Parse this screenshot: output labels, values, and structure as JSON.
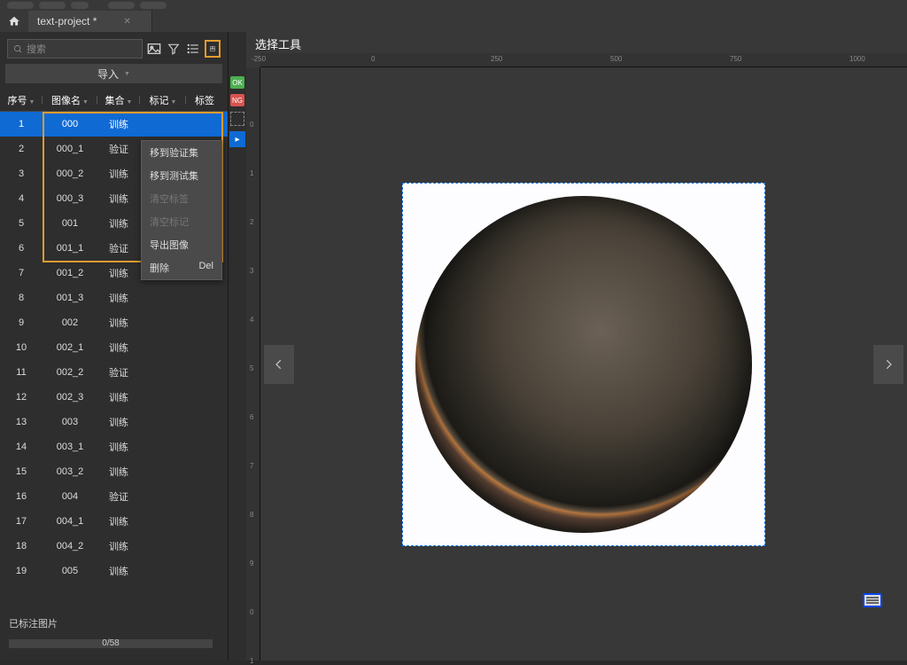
{
  "tab_title": "text-project *",
  "search_placeholder": "搜索",
  "import_label": "导入",
  "headers": {
    "no": "序号",
    "image": "图像名",
    "set": "集合",
    "mark": "标记",
    "tag": "标签"
  },
  "rows": [
    {
      "no": "1",
      "name": "000",
      "set": "训练",
      "sel": true
    },
    {
      "no": "2",
      "name": "000_1",
      "set": "验证"
    },
    {
      "no": "3",
      "name": "000_2",
      "set": "训练"
    },
    {
      "no": "4",
      "name": "000_3",
      "set": "训练"
    },
    {
      "no": "5",
      "name": "001",
      "set": "训练"
    },
    {
      "no": "6",
      "name": "001_1",
      "set": "验证"
    },
    {
      "no": "7",
      "name": "001_2",
      "set": "训练"
    },
    {
      "no": "8",
      "name": "001_3",
      "set": "训练"
    },
    {
      "no": "9",
      "name": "002",
      "set": "训练"
    },
    {
      "no": "10",
      "name": "002_1",
      "set": "训练"
    },
    {
      "no": "11",
      "name": "002_2",
      "set": "验证"
    },
    {
      "no": "12",
      "name": "002_3",
      "set": "训练"
    },
    {
      "no": "13",
      "name": "003",
      "set": "训练"
    },
    {
      "no": "14",
      "name": "003_1",
      "set": "训练"
    },
    {
      "no": "15",
      "name": "003_2",
      "set": "训练"
    },
    {
      "no": "16",
      "name": "004",
      "set": "验证"
    },
    {
      "no": "17",
      "name": "004_1",
      "set": "训练"
    },
    {
      "no": "18",
      "name": "004_2",
      "set": "训练"
    },
    {
      "no": "19",
      "name": "005",
      "set": "训练"
    }
  ],
  "context_menu": {
    "move_validate": "移到验证集",
    "move_test": "移到测试集",
    "clear_tags": "清空标签",
    "clear_marks": "清空标记",
    "export": "导出图像",
    "delete": "删除",
    "delete_key": "Del"
  },
  "footer_label": "已标注图片",
  "progress_text": "0/58",
  "canvas_title": "选择工具",
  "badges": {
    "ok": "OK",
    "ng": "NG"
  },
  "ruler_top": [
    "-250",
    "0",
    "250",
    "500",
    "750",
    "1000"
  ],
  "ruler_left": [
    "0",
    "1",
    "2",
    "3",
    "4",
    "5",
    "6",
    "7",
    "8",
    "9",
    "0",
    "1"
  ]
}
